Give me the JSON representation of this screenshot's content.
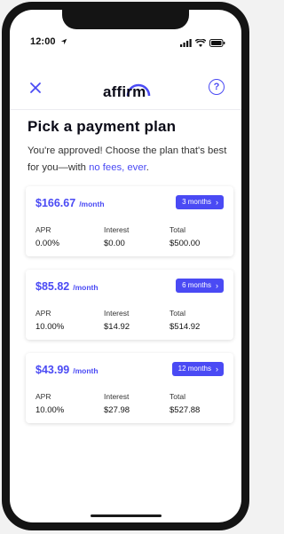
{
  "status_bar": {
    "time": "12:00",
    "icons": [
      "location-arrow-icon",
      "signal-icon",
      "wifi-icon",
      "battery-icon"
    ]
  },
  "header": {
    "logo_text": "affirm",
    "close_icon": "close-icon",
    "help_icon": "help-circle-icon",
    "help_glyph": "?"
  },
  "main": {
    "title": "Pick a payment plan",
    "subtitle_before": "You're approved! Choose the plan that's best for you—with ",
    "subtitle_link": "no fees, ever",
    "subtitle_after": "."
  },
  "plan_labels": {
    "apr": "APR",
    "interest": "Interest",
    "total": "Total",
    "unit": "/month"
  },
  "plans": [
    {
      "amount": "$166.67",
      "unit": "/month",
      "button": "3 months",
      "apr": "0.00%",
      "interest": "$0.00",
      "total": "$500.00"
    },
    {
      "amount": "$85.82",
      "unit": "/month",
      "button": "6 months",
      "apr": "10.00%",
      "interest": "$14.92",
      "total": "$514.92"
    },
    {
      "amount": "$43.99",
      "unit": "/month",
      "button": "12 months",
      "apr": "10.00%",
      "interest": "$27.98",
      "total": "$527.88"
    }
  ],
  "colors": {
    "accent": "#4a4af4",
    "text": "#0a0a17",
    "phone_frame": "#141414"
  }
}
